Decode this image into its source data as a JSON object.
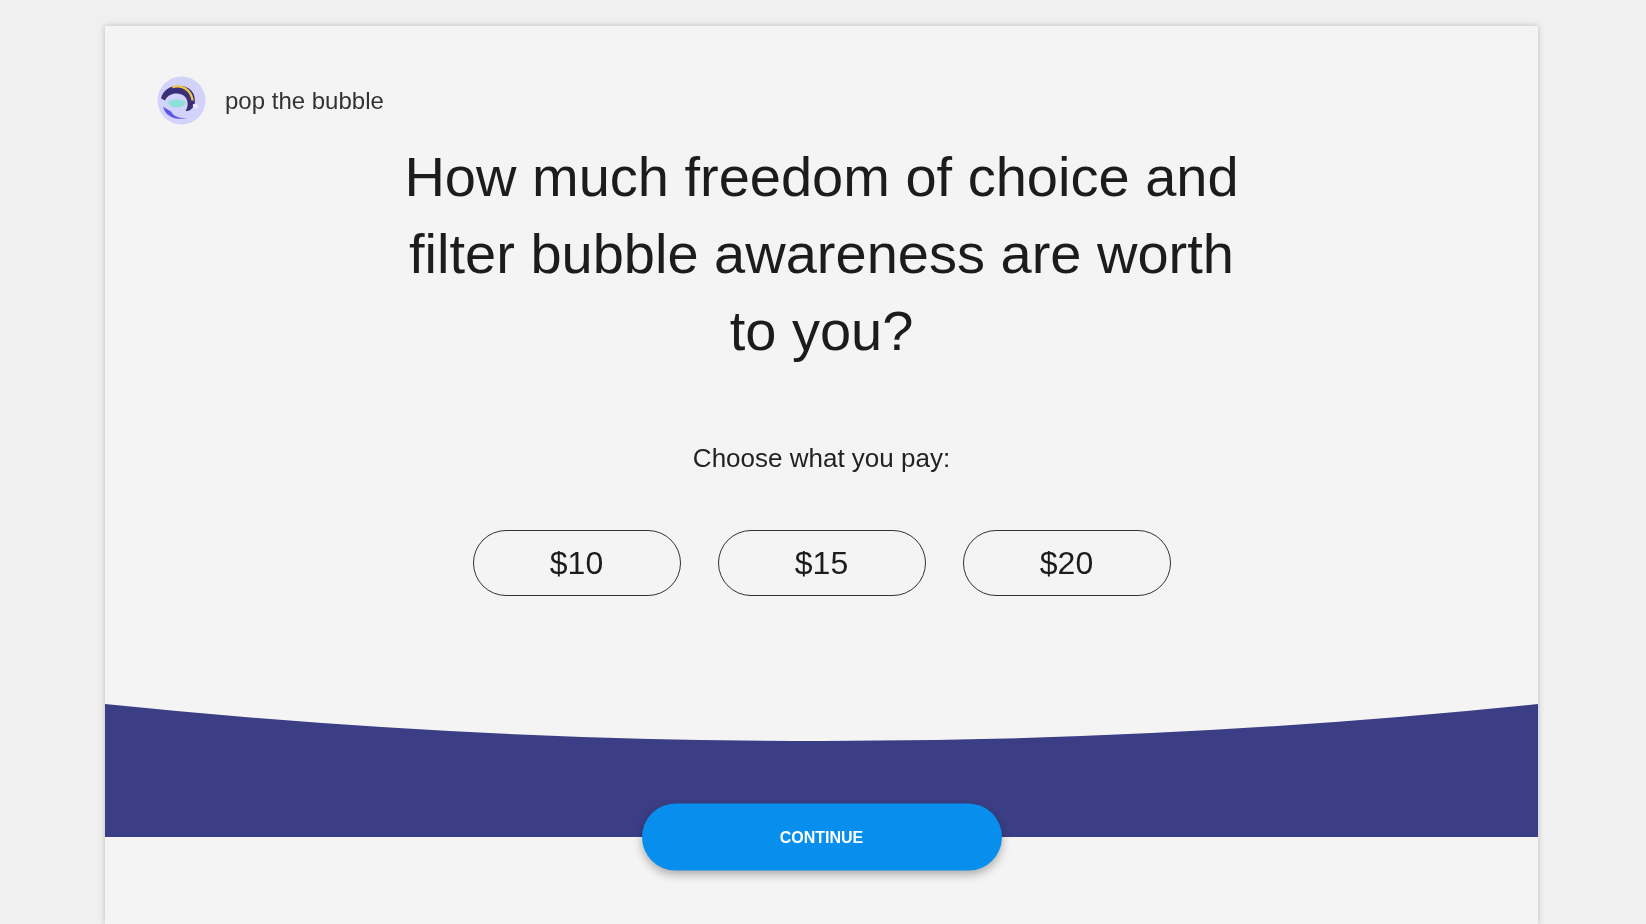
{
  "brand": {
    "name": "pop the bubble"
  },
  "question": "How much freedom of choice and filter bubble awareness are worth to you?",
  "price_prompt": "Choose what you pay:",
  "price_options": [
    {
      "label": "$10",
      "selected": false
    },
    {
      "label": "$15",
      "selected": false
    },
    {
      "label": "$20",
      "selected": false
    }
  ],
  "continue_button": {
    "label": "CONTINUE"
  }
}
